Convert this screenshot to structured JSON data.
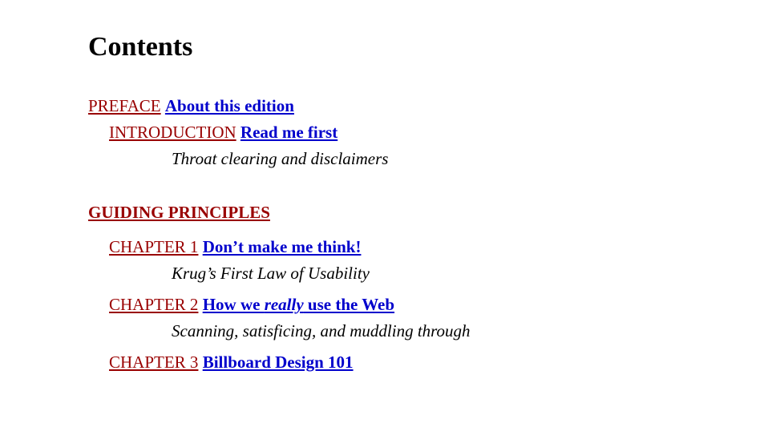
{
  "heading": "Contents",
  "entries": [
    {
      "label": "PREFACE",
      "title": "About this edition",
      "subtitle": null,
      "indent": 0
    },
    {
      "label": "INTRODUCTION",
      "title": "Read me first",
      "subtitle": "Throat clearing and disclaimers",
      "indent": 1
    }
  ],
  "section": {
    "heading": "GUIDING PRINCIPLES",
    "chapters": [
      {
        "label": "CHAPTER 1",
        "title_html": "Don’t make me think!",
        "subtitle": "Krug’s First Law of Usability"
      },
      {
        "label": "CHAPTER 2",
        "title_html": "How we <em>really</em> use the Web",
        "subtitle": "Scanning, satisficing, and muddling through"
      },
      {
        "label": "CHAPTER 3",
        "title_html": "Billboard Design 101",
        "subtitle": null
      }
    ]
  }
}
